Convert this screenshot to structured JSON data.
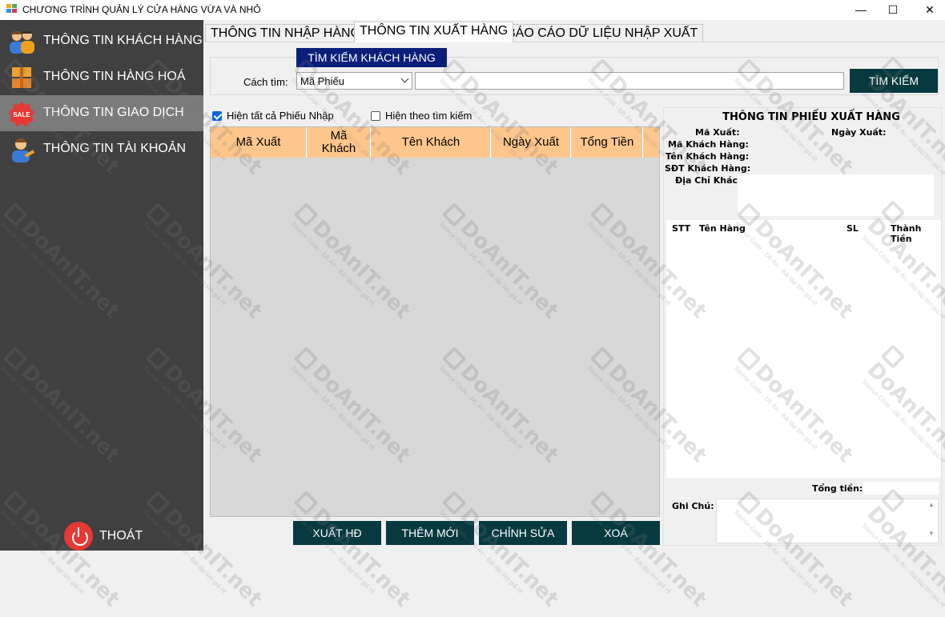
{
  "window": {
    "title": "CHƯƠNG TRÌNH QUẢN LÝ CỬA HÀNG VỪA VÀ NHỎ"
  },
  "sidebar": {
    "items": [
      {
        "label": "THÔNG TIN KHÁCH HÀNG",
        "icon": "customers-icon"
      },
      {
        "label": "THÔNG TIN HÀNG HOÁ",
        "icon": "goods-box-icon"
      },
      {
        "label": "THÔNG TIN GIAO DỊCH",
        "icon": "sale-badge-icon"
      },
      {
        "label": "THÔNG TIN TÀI KHOẢN",
        "icon": "account-user-icon"
      }
    ],
    "exit_label": "THOÁT",
    "active_index": 2
  },
  "tabs": [
    {
      "label": "THÔNG TIN NHẬP HÀNG"
    },
    {
      "label": "THÔNG TIN XUẤT HÀNG"
    },
    {
      "label": "BÁO CÁO DỮ LIỆU NHẬP XUẤT"
    }
  ],
  "search": {
    "group_title": "TÌM KIẾM KHÁCH HÀNG",
    "method_label": "Cách tìm:",
    "method_value": "Mã Phiếu",
    "input_value": "",
    "button": "TÌM KIẾM"
  },
  "filters": {
    "show_all": "Hiện tất cả Phiếu Nhập",
    "show_search": "Hiện theo tìm kiếm"
  },
  "grid": {
    "columns": [
      "Mã Xuất",
      "Mã\nKhách",
      "Tên Khách",
      "Ngày Xuất",
      "Tổng Tiền"
    ],
    "rows": []
  },
  "actions": {
    "export": "XUẤT HĐ",
    "add": "THÊM MỚI",
    "edit": "CHỈNH SỬA",
    "delete": "XOÁ"
  },
  "detail": {
    "title": "THÔNG TIN PHIẾU XUẤT HÀNG",
    "ma_xuat": "Mã Xuất:",
    "ngay_xuat": "Ngày Xuất:",
    "ma_khach": "Mã Khách Hàng:",
    "ten_khach": "Tên Khách Hàng:",
    "sdt": "SĐT Khách Hàng:",
    "dia_chi": "Địa Chỉ Khách:",
    "item_headers": {
      "stt": "STT",
      "ten_hang": "Tên Hàng",
      "sl": "SL",
      "thanh_tien": "Thành Tiền"
    },
    "tong_tien": "Tổng tiền:",
    "ghi_chu": "Ghi Chú:"
  },
  "watermark": {
    "text": "DoAnIT.net",
    "sub": "Source Code - Đồ Án - Bài tập lớn giá rẻ"
  },
  "colors": {
    "sidebar_bg": "#404040",
    "sidebar_active": "#7b7b7b",
    "accent_dark": "#073a40",
    "group_title_bg": "#0b1f7a",
    "grid_header": "#ffc68c"
  }
}
